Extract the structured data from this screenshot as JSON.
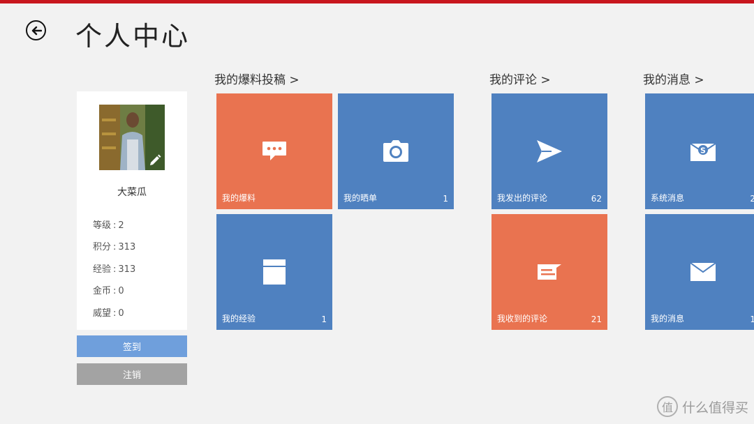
{
  "header": {
    "title": "个人中心"
  },
  "profile": {
    "name": "大菜瓜",
    "stats": [
      {
        "label": "等级",
        "value": "2"
      },
      {
        "label": "积分",
        "value": "313"
      },
      {
        "label": "经验",
        "value": "313"
      },
      {
        "label": "金币",
        "value": "0"
      },
      {
        "label": "威望",
        "value": "0"
      }
    ]
  },
  "actions": {
    "checkin": "签到",
    "logout": "注销"
  },
  "sections": [
    {
      "title": "我的爆料投稿 >"
    },
    {
      "title": "我的评论 >"
    },
    {
      "title": "我的消息 >"
    }
  ],
  "tiles": [
    {
      "label": "我的爆料",
      "count": "",
      "color": "#e97350",
      "icon": "chat-bubble-icon"
    },
    {
      "label": "我的晒单",
      "count": "1",
      "color": "#4f81c0",
      "icon": "camera-icon"
    },
    {
      "label": "我的经验",
      "count": "1",
      "color": "#4f81c0",
      "icon": "box-icon"
    },
    {
      "label": "我发出的评论",
      "count": "62",
      "color": "#4f81c0",
      "icon": "send-icon"
    },
    {
      "label": "我收到的评论",
      "count": "21",
      "color": "#e97350",
      "icon": "comment-icon"
    },
    {
      "label": "系统消息",
      "count": "2",
      "color": "#4f81c0",
      "icon": "dollar-envelope-icon"
    },
    {
      "label": "我的消息",
      "count": "1",
      "color": "#4f81c0",
      "icon": "envelope-icon"
    }
  ],
  "watermark": {
    "text": "什么值得买",
    "logo_char": "值"
  }
}
